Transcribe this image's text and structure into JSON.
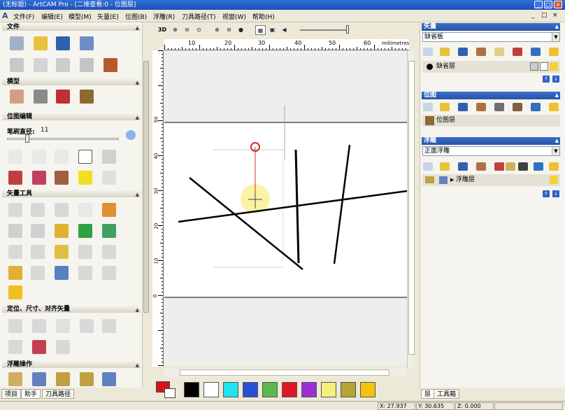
{
  "window": {
    "title": "(无标题) - ArtCAM Pro - [二维查看:0 - 位图层]"
  },
  "menubar": {
    "items": [
      "文件(F)",
      "编辑(E)",
      "模型(M)",
      "矢量(E)",
      "位图(B)",
      "浮雕(R)",
      "刀具路径(T)",
      "视窗(W)",
      "帮助(H)"
    ]
  },
  "left_panel": {
    "sections": [
      {
        "title": "文件"
      },
      {
        "title": "模型"
      },
      {
        "title": "位图编辑"
      },
      {
        "title": "矢量工具"
      },
      {
        "title": "定位、尺寸、对齐矢量"
      },
      {
        "title": "浮雕操作"
      }
    ],
    "brush_label": "笔刷直径:",
    "brush_value": "11",
    "tabs": [
      "项目",
      "助手",
      "刀具路径"
    ]
  },
  "view_toolbar": {
    "mode_label": "3D"
  },
  "ruler": {
    "h_ticks": [
      "10",
      "20",
      "30",
      "40",
      "50",
      "60"
    ],
    "unit": "millimetres",
    "v_ticks": [
      "50",
      "40",
      "30",
      "20",
      "10",
      "0"
    ]
  },
  "colors": {
    "primary": "#d4141c",
    "secondary": "#ffffff",
    "palette": [
      "#000000",
      "#ffffff",
      "#1fe3f0",
      "#2a4fd6",
      "#5cb84a",
      "#e01526",
      "#9b2fd6",
      "#f4f07a",
      "#b3a433",
      "#f2c40f"
    ]
  },
  "right_panel": {
    "vector": {
      "title": "矢量",
      "dropdown": "缺省板",
      "layer": "缺省层"
    },
    "bitmap": {
      "title": "位图",
      "layer": "位图层"
    },
    "relief": {
      "title": "浮雕",
      "dropdown": "正面浮雕",
      "layer": "浮雕层"
    },
    "tabs": [
      "层",
      "工具箱"
    ]
  },
  "status": {
    "x": "X: 27.937",
    "y": "Y: 30.635",
    "z": "Z: 0.000"
  }
}
